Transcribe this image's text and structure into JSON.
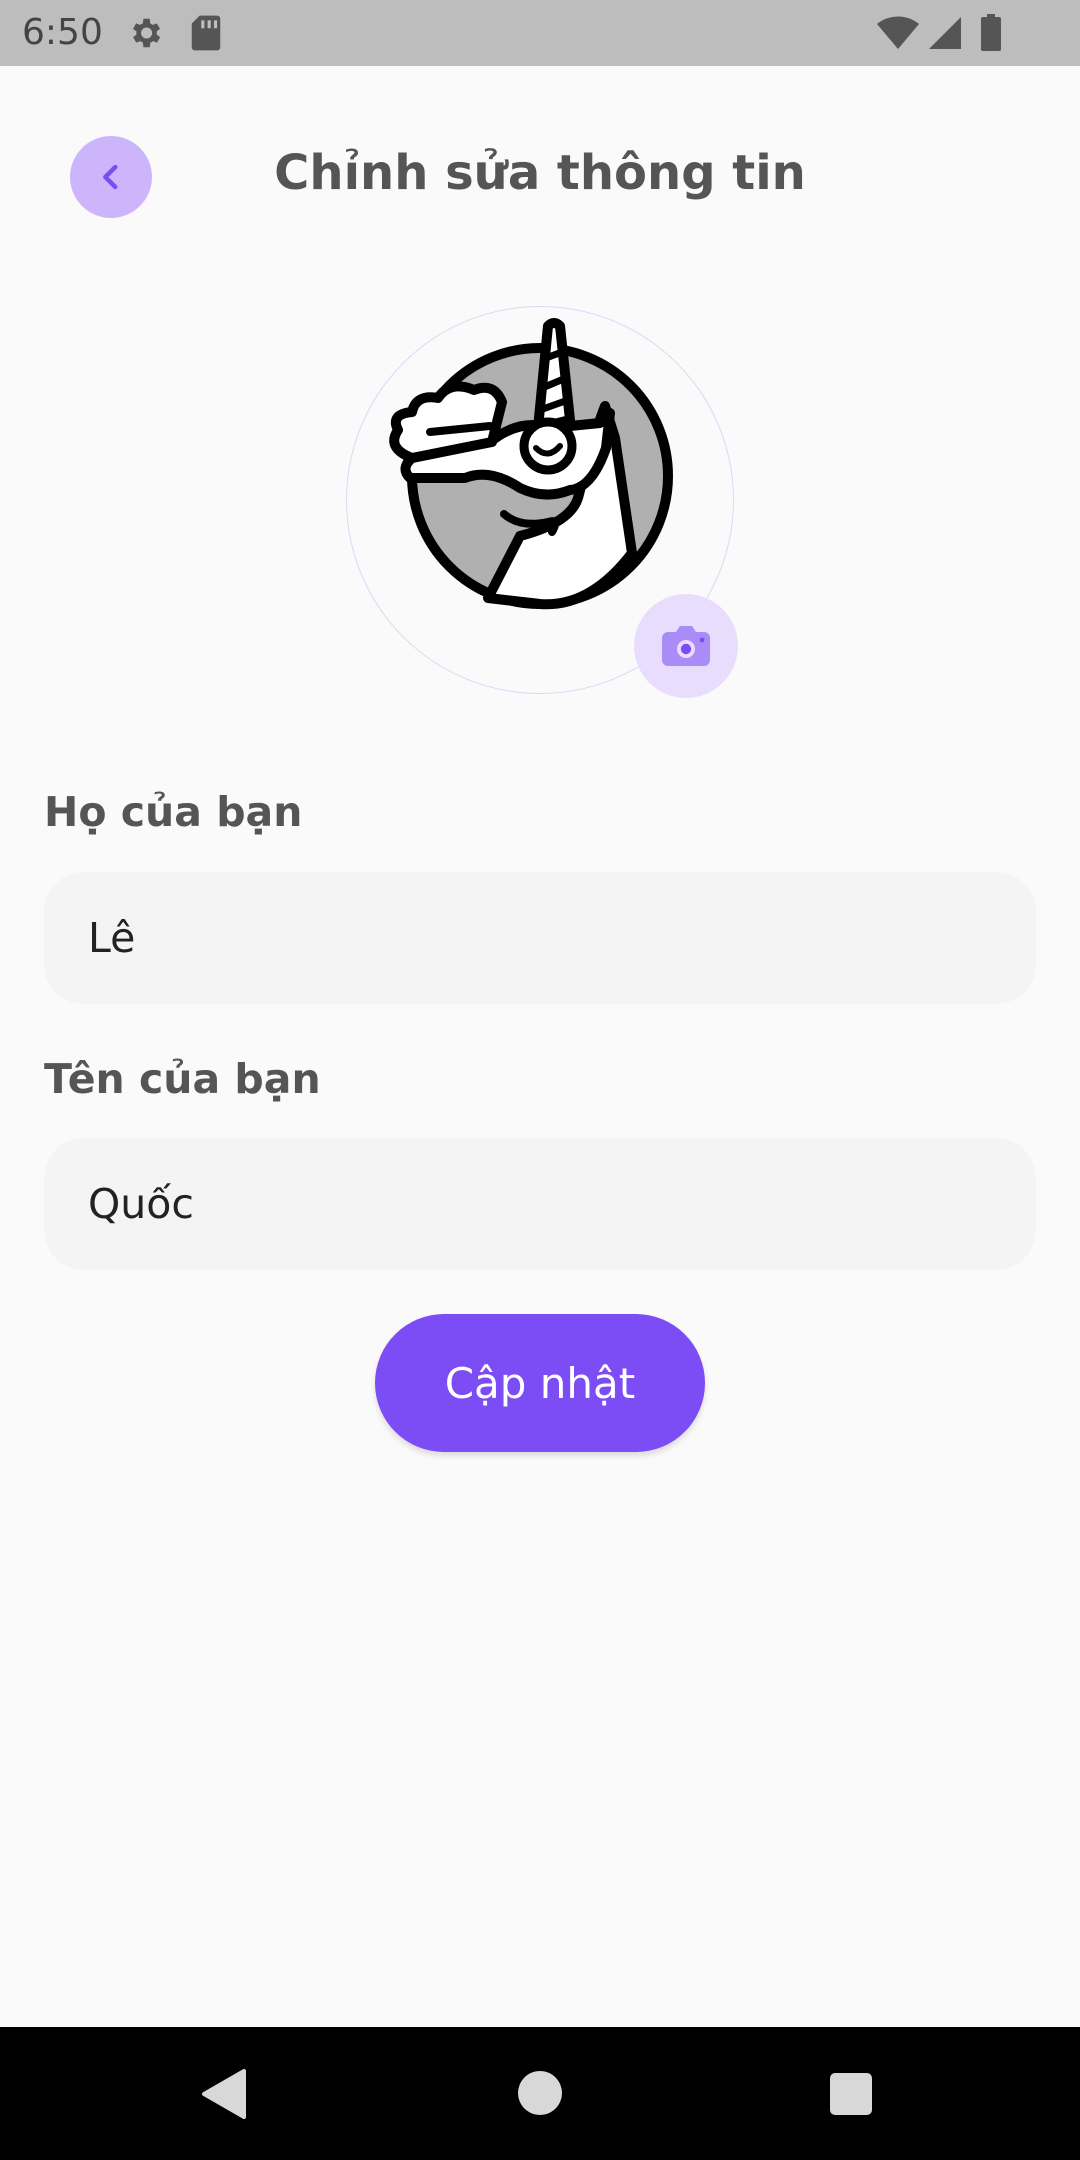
{
  "status_bar": {
    "time": "6:50",
    "icons": [
      "gear-icon",
      "sd-card-icon",
      "wifi-icon",
      "signal-icon",
      "battery-icon"
    ]
  },
  "header": {
    "title": "Chỉnh sửa thông tin",
    "back_icon": "chevron-left-icon"
  },
  "avatar": {
    "image": "unicorn-avatar",
    "camera_icon": "camera-icon"
  },
  "form": {
    "last_name": {
      "label": "Họ của bạn",
      "value": "Lê"
    },
    "first_name": {
      "label": "Tên của bạn",
      "value": "Quốc"
    },
    "submit_label": "Cập nhật"
  },
  "nav_bar": {
    "icons": [
      "nav-back-icon",
      "nav-home-icon",
      "nav-recents-icon"
    ]
  },
  "colors": {
    "accent": "#7c4df5",
    "accent_light": "#cdb5fb",
    "accent_pale": "#e9ddfd",
    "background": "#fafafa",
    "status_bar": "#bdbdbd",
    "input_background": "#f4f4f4"
  }
}
